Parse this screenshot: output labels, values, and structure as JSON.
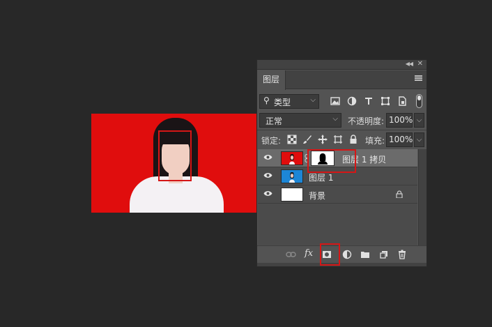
{
  "panel": {
    "tab_label": "图层",
    "filter": {
      "selected": "类型"
    },
    "blend_mode": "正常",
    "opacity_label": "不透明度:",
    "opacity_value": "100%",
    "lock_label": "锁定:",
    "fill_label": "填充:",
    "fill_value": "100%",
    "layers": [
      {
        "name": "图层 1 拷贝",
        "visible": true,
        "active": true,
        "has_mask": true
      },
      {
        "name": "图层 1",
        "visible": true,
        "active": false,
        "has_mask": false
      },
      {
        "name": "背景",
        "visible": true,
        "active": false,
        "locked": true
      }
    ]
  },
  "colors": {
    "canvas_background": "#e00d0d",
    "highlight_box": "#d51616",
    "layer_thumb_blue": "#1d86d6",
    "panel_bg": "#535353",
    "app_bg": "#282828"
  },
  "icons": {
    "filter_icons": [
      "image-filter-icon",
      "adjustment-filter-icon",
      "type-filter-icon",
      "shape-filter-icon",
      "smart-object-filter-icon"
    ],
    "lock_icons": [
      "lock-transparent-pixels-icon",
      "lock-image-pixels-icon",
      "lock-position-icon",
      "lock-artboard-icon",
      "lock-all-icon"
    ],
    "bottom_icons": [
      "link-layers-icon",
      "fx-icon",
      "add-mask-icon",
      "adjustment-layer-icon",
      "group-folder-icon",
      "new-layer-icon",
      "delete-layer-icon"
    ]
  }
}
